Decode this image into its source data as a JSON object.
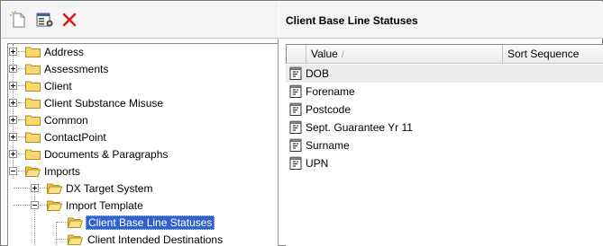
{
  "toolbar": {
    "new_icon": "new-item-icon",
    "properties_icon": "properties-icon",
    "delete_icon": "delete-icon",
    "delete_color": "#d21f1f"
  },
  "tree": {
    "items": [
      {
        "label": "Address",
        "state": "collapsed"
      },
      {
        "label": "Assessments",
        "state": "collapsed"
      },
      {
        "label": "Client",
        "state": "collapsed"
      },
      {
        "label": "Client Substance Misuse",
        "state": "collapsed"
      },
      {
        "label": "Common",
        "state": "collapsed"
      },
      {
        "label": "ContactPoint",
        "state": "collapsed"
      },
      {
        "label": "Documents & Paragraphs",
        "state": "collapsed"
      },
      {
        "label": "Imports",
        "state": "expanded"
      },
      {
        "label": "DX Target System",
        "state": "collapsed"
      },
      {
        "label": "Import Template",
        "state": "expanded"
      },
      {
        "label": "Client Base Line Statuses",
        "state": "selected"
      },
      {
        "label": "Client Intended Destinations",
        "state": "leaf"
      }
    ],
    "selection_color": "#2f63ce"
  },
  "panel": {
    "title": "Client Base Line Statuses"
  },
  "grid": {
    "columns": [
      {
        "label": "Value",
        "sort": "/"
      },
      {
        "label": "Sort Sequence"
      }
    ],
    "rows": [
      {
        "value": "DOB"
      },
      {
        "value": "Forename"
      },
      {
        "value": "Postcode"
      },
      {
        "value": "Sept. Guarantee Yr 11"
      },
      {
        "value": "Surname"
      },
      {
        "value": "UPN"
      }
    ]
  }
}
